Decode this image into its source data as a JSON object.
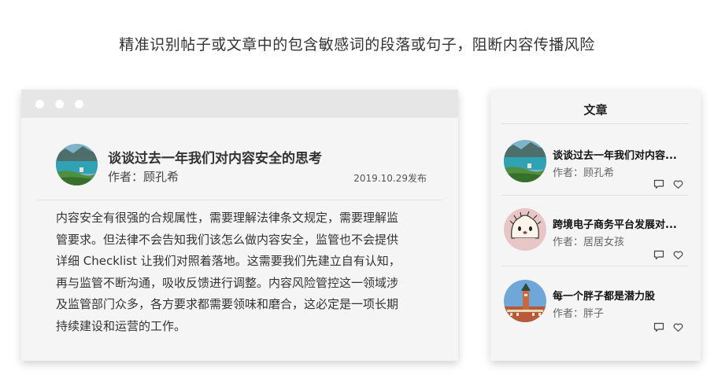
{
  "headline": "精准识别帖子或文章中的包含敏感词的段落或句子，阻断内容传播风险",
  "post": {
    "title": "谈谈过去一年我们对内容安全的思考",
    "author": "作者：顾孔希",
    "date": "2019.10.29发布",
    "body_lines": [
      "内容安全有很强的合规属性，需要理解法律条文规定，需要理解监",
      "管要求。但法律不会告知我们该怎么做内容安全，监管也不会提供",
      "详细 Checklist 让我们对照着落地。这需要我们先建立自有认知，",
      "再与监管不断沟通，吸收反馈进行调整。内容风险管控这一领域涉",
      "及监管部门众多，各方要求都需要领味和磨合，这必定是一项长期",
      "持续建设和运营的工作。"
    ]
  },
  "panel": {
    "title": "文章",
    "items": [
      {
        "title": "谈谈过去一年我们对内容...",
        "author": "作者：顾孔希",
        "avatar": "lake-landscape"
      },
      {
        "title": "跨境电子商务平台发展对...",
        "author": "作者：居居女孩",
        "avatar": "hedgehog-cartoon"
      },
      {
        "title": "每一个胖子都是潜力股",
        "author": "作者：胖子",
        "avatar": "castle-tower"
      }
    ]
  },
  "icons": {
    "comment": "comment-icon",
    "like": "heart-icon"
  }
}
